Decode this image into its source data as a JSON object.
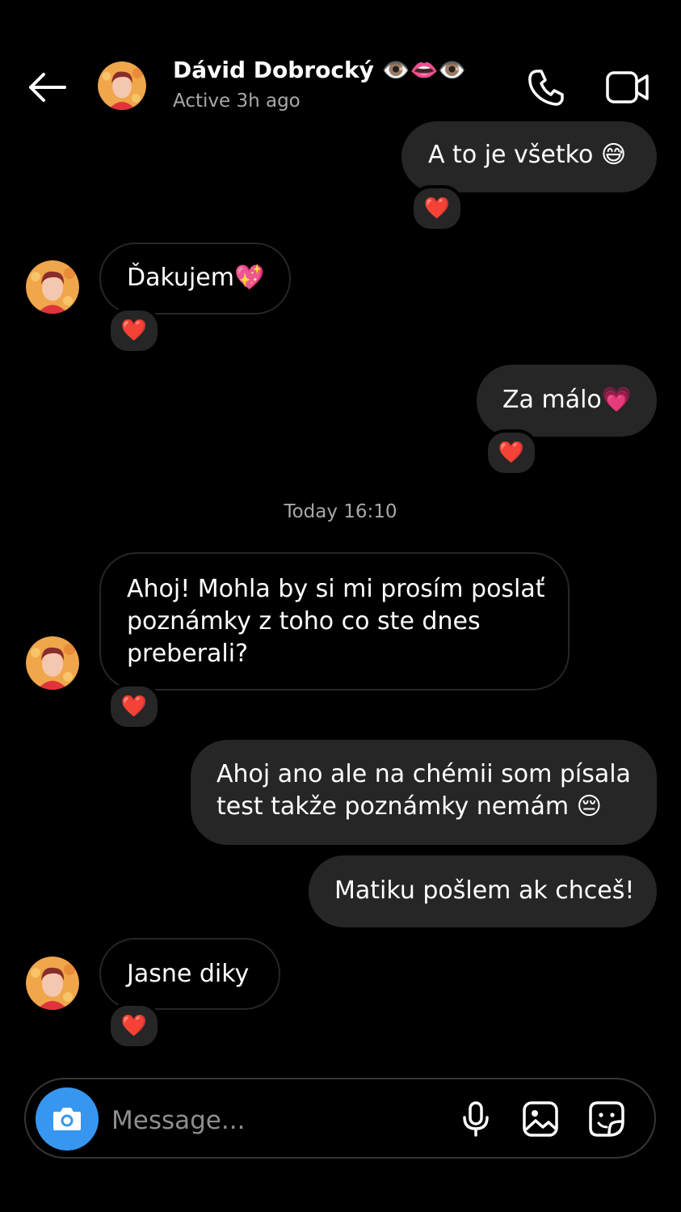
{
  "header": {
    "name": "Dávid Dobrocký",
    "name_emojis": "👁️👄👁️",
    "status": "Active 3h ago",
    "icons": [
      "back-arrow-icon",
      "phone-icon",
      "video-camera-icon"
    ]
  },
  "messages": [
    {
      "from": "me",
      "text": "A to je všetko 😅",
      "reaction": "❤️"
    },
    {
      "from": "them",
      "text": "Ďakujem💖",
      "reaction": "❤️"
    },
    {
      "from": "me",
      "text": "Za málo💗",
      "reaction": "❤️"
    },
    {
      "from": "them",
      "text": "Ahoj! Mohla by si mi prosím poslať\npoznámky z toho co ste dnes\npreberali?",
      "reaction": "❤️"
    },
    {
      "from": "me",
      "text": "Ahoj ano ale na chémii som písala\ntest takže poznámky nemám 😔"
    },
    {
      "from": "me",
      "text": "Matiku pošlem ak chceš!"
    },
    {
      "from": "them",
      "text": "Jasne diky",
      "reaction": "❤️"
    }
  ],
  "timestamp": "Today 16:10",
  "composer": {
    "placeholder": "Message...",
    "icons": [
      "camera-icon",
      "microphone-icon",
      "gallery-icon",
      "sticker-icon"
    ]
  },
  "colors": {
    "background": "#000000",
    "bubble": "#262626",
    "camera_button": "#3797f0",
    "secondary_text": "#a8a8a8"
  }
}
